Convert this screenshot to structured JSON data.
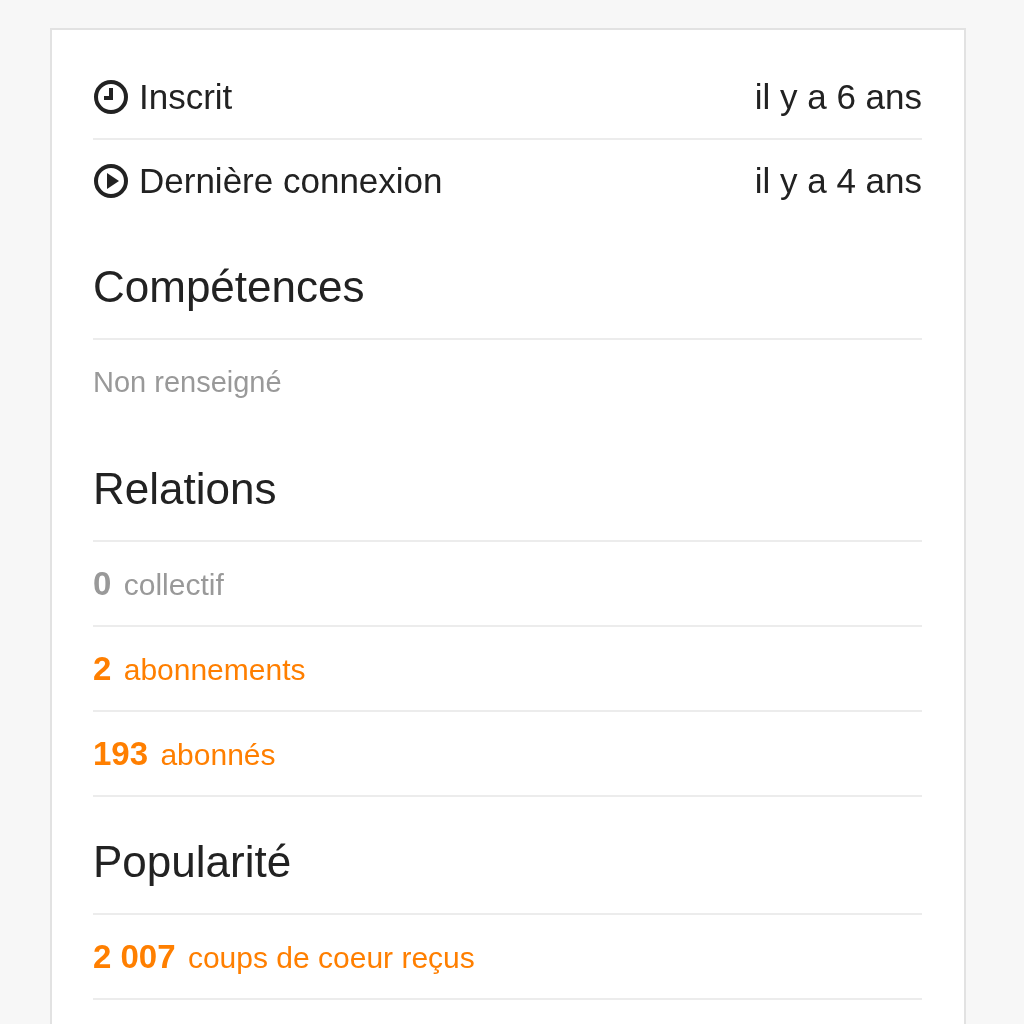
{
  "info_rows": [
    {
      "kind": "clock",
      "label": "Inscrit",
      "value": "il y a 6 ans"
    },
    {
      "kind": "play",
      "label": "Dernière connexion",
      "value": "il y a 4 ans"
    }
  ],
  "sections": [
    {
      "title": "Compétences",
      "items": [
        {
          "kind": "note",
          "text": "Non renseigné"
        }
      ]
    },
    {
      "title": "Relations",
      "items": [
        {
          "kind": "stat",
          "text": "**0** collectif",
          "disabled": true
        },
        {
          "kind": "stat",
          "text": "**2** abonnements",
          "disabled": false
        },
        {
          "kind": "stat",
          "text": "**193** abonnés",
          "disabled": false
        }
      ]
    },
    {
      "title": "Popularité",
      "items": [
        {
          "kind": "stat",
          "text": "**2 007** coups de coeur reçus",
          "disabled": false
        }
      ]
    }
  ]
}
